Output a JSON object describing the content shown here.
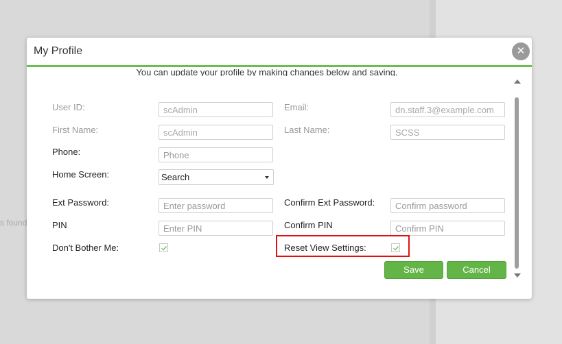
{
  "background": {
    "partial_text": "s found"
  },
  "modal": {
    "title": "My Profile",
    "intro": "You can update your profile by making changes below and saving.",
    "close_icon": "close-icon"
  },
  "form": {
    "user_id": {
      "label": "User ID:",
      "value": "scAdmin"
    },
    "email": {
      "label": "Email:",
      "value": "dn.staff.3@example.com"
    },
    "first_name": {
      "label": "First Name:",
      "value": "scAdmin"
    },
    "last_name": {
      "label": "Last Name:",
      "value": "SCSS"
    },
    "phone": {
      "label": "Phone:",
      "placeholder": "Phone"
    },
    "home_screen": {
      "label": "Home Screen:",
      "value": "Search"
    },
    "ext_password": {
      "label": "Ext Password:",
      "placeholder": "Enter password"
    },
    "confirm_ext_password": {
      "label": "Confirm Ext Password:",
      "placeholder": "Confirm password"
    },
    "pin": {
      "label": "PIN",
      "placeholder": "Enter PIN"
    },
    "confirm_pin": {
      "label": "Confirm PIN",
      "placeholder": "Confirm PIN"
    },
    "dont_bother_me": {
      "label": "Don't Bother Me:",
      "checked": true
    },
    "reset_view_settings": {
      "label": "Reset View Settings:",
      "checked": true
    }
  },
  "buttons": {
    "save": "Save",
    "cancel": "Cancel"
  },
  "colors": {
    "accent": "#64b548",
    "header_rule": "#6abf4b",
    "highlight": "#e01010"
  }
}
